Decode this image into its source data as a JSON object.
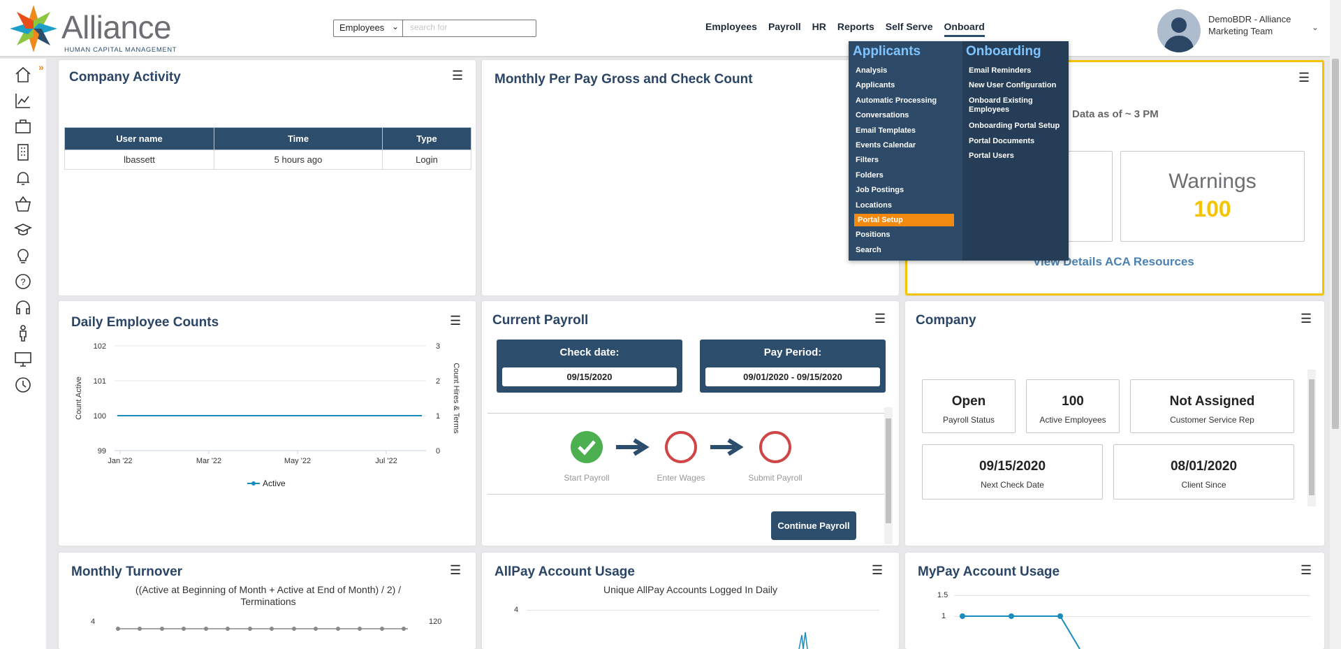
{
  "logo": {
    "brand": "Alliance",
    "tagline": "HUMAN CAPITAL MANAGEMENT"
  },
  "search": {
    "scope": "Employees",
    "placeholder": "search for"
  },
  "nav": [
    "Employees",
    "Payroll",
    "HR",
    "Reports",
    "Self Serve",
    "Onboard"
  ],
  "user": {
    "name": "DemoBDR - Alliance Marketing Team"
  },
  "sidebar": {
    "icons": [
      "home-icon",
      "analytics-icon",
      "briefcase-icon",
      "building-icon",
      "bell-icon",
      "basket-icon",
      "graduation-cap-icon",
      "lightbulb-icon",
      "help-icon",
      "headset-icon",
      "person-icon",
      "monitor-icon",
      "clock-icon"
    ]
  },
  "company_activity": {
    "title": "Company Activity",
    "columns": [
      "User name",
      "Time",
      "Type"
    ],
    "rows": [
      [
        "lbassett",
        "5 hours ago",
        "Login"
      ]
    ]
  },
  "monthly_gross": {
    "title": "Monthly Per Pay Gross and Check Count"
  },
  "aca": {
    "data_as_of": "Data as of ~ 3 PM",
    "warnings_label": "Warnings",
    "warnings_value": "100",
    "link": "View Details ACA Resources"
  },
  "daily_counts": {
    "title": "Daily Employee Counts"
  },
  "chart_data": [
    {
      "type": "line",
      "title": "Daily Employee Counts",
      "ylabel": "Count Active",
      "y2label": "Count Hires & Terms",
      "ylim": [
        99,
        102
      ],
      "y2lim": [
        0,
        3
      ],
      "yticks": [
        "102",
        "101",
        "100",
        "99"
      ],
      "y2ticks": [
        "3",
        "2",
        "1",
        "0"
      ],
      "categories": [
        "Jan '22",
        "Mar '22",
        "May '22",
        "Jul '22"
      ],
      "series": [
        {
          "name": "Active",
          "values": [
            100,
            100,
            100,
            100
          ],
          "color": "#1a8bbd"
        }
      ],
      "legend": "bottom"
    }
  ],
  "current_payroll": {
    "title": "Current Payroll",
    "check_date_label": "Check date:",
    "check_date": "09/15/2020",
    "pay_period_label": "Pay Period:",
    "pay_period": "09/01/2020 - 09/15/2020",
    "steps": [
      "Start Payroll",
      "Enter Wages",
      "Submit Payroll"
    ],
    "continue": "Continue Payroll"
  },
  "company": {
    "title": "Company",
    "stats": [
      {
        "value": "Open",
        "label": "Payroll Status"
      },
      {
        "value": "100",
        "label": "Active Employees"
      },
      {
        "value": "Not Assigned",
        "label": "Customer Service Rep"
      },
      {
        "value": "09/15/2020",
        "label": "Next Check Date"
      },
      {
        "value": "08/01/2020",
        "label": "Client Since"
      }
    ]
  },
  "turnover": {
    "title": "Monthly Turnover",
    "formula": "((Active at Beginning of Month + Active at End of Month) / 2) / Terminations",
    "ytick": "4",
    "y2tick": "120"
  },
  "allpay": {
    "title": "AllPay Account Usage",
    "subtitle": "Unique AllPay Accounts Logged In Daily",
    "ytick": "4"
  },
  "mypay": {
    "title": "MyPay Account Usage",
    "yticks": [
      "1.5",
      "1"
    ]
  },
  "dropdown": {
    "applicants_header": "Applicants",
    "applicants": [
      "Analysis",
      "Applicants",
      "Automatic Processing",
      "Conversations",
      "Email Templates",
      "Events Calendar",
      "Filters",
      "Folders",
      "Job Postings",
      "Locations",
      "Portal Setup",
      "Positions",
      "Search"
    ],
    "onboarding_header": "Onboarding",
    "onboarding": [
      "Email Reminders",
      "New User Configuration",
      "Onboard Existing Employees",
      "Onboarding Portal Setup",
      "Portal Documents",
      "Portal Users"
    ]
  },
  "colors": {
    "navy": "#2d4d6d",
    "orange": "#f28a12",
    "yellow": "#f5c400",
    "green": "#4caf50",
    "red": "#d04545"
  }
}
